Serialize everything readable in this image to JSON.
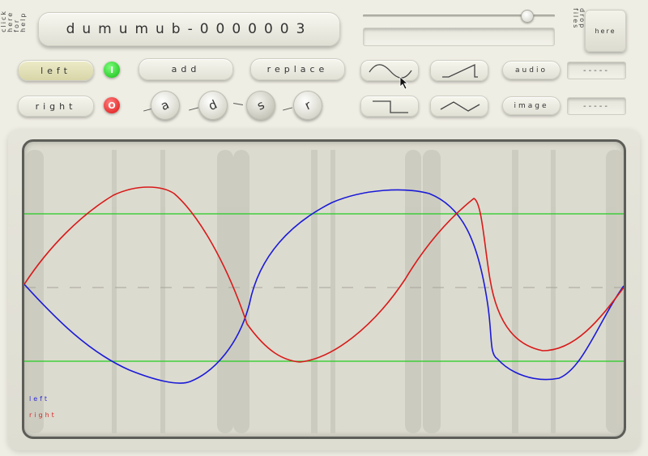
{
  "header": {
    "help_label": "click\nhere\nfor\nhelp",
    "title": "dumumub-0000003",
    "drop_label": "drop\nfiles",
    "drop_target": "here"
  },
  "slider": {
    "value": 0.83
  },
  "channels": {
    "left_label": "left",
    "right_label": "right",
    "left_led": "I",
    "right_led": "O",
    "left_led_color": "#22cc22",
    "right_led_color": "#ee2222"
  },
  "actions": {
    "add_label": "add",
    "replace_label": "replace"
  },
  "envelope": {
    "knobs": [
      {
        "label": "a",
        "name": "attack"
      },
      {
        "label": "d",
        "name": "decay"
      },
      {
        "label": "s",
        "name": "sustain"
      },
      {
        "label": "r",
        "name": "release"
      }
    ]
  },
  "waveforms": {
    "sine_icon": "sine-wave-icon",
    "saw_icon": "sawtooth-wave-icon",
    "square_icon": "square-wave-icon",
    "triangle_icon": "triangle-wave-icon"
  },
  "export": {
    "audio_label": "audio",
    "image_label": "image",
    "audio_value": "-----",
    "image_value": "-----"
  },
  "display": {
    "legend_left": "left",
    "legend_right": "right",
    "left_color": "#1a1ad8",
    "right_color": "#d81a1a",
    "guide_color": "#22cc22"
  }
}
